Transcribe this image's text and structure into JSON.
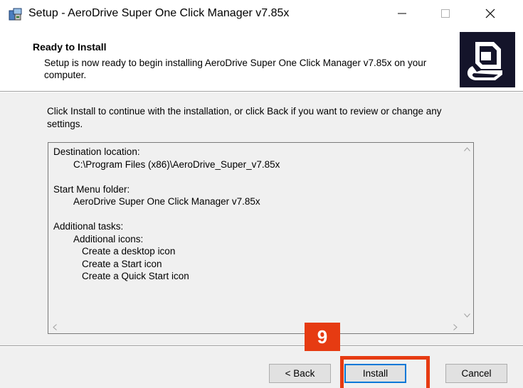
{
  "window": {
    "title": "Setup - AeroDrive Super One Click Manager v7.85x",
    "controls": {
      "minimize": "—",
      "maximize": "☐",
      "close": "✕"
    }
  },
  "header": {
    "title": "Ready to Install",
    "description": "Setup is now ready to begin installing AeroDrive Super One Click Manager v7.85x on your computer.",
    "logo_icon": "computer-install-icon"
  },
  "content": {
    "intro": "Click Install to continue with the installation, or click Back if you want to review or change any settings.",
    "memo": {
      "destination_label": "Destination location:",
      "destination_value": "C:\\Program Files (x86)\\AeroDrive_Super_v7.85x",
      "start_menu_label": "Start Menu folder:",
      "start_menu_value": "AeroDrive Super One Click Manager v7.85x",
      "tasks_label": "Additional tasks:",
      "icons_label": "Additional icons:",
      "tasks": [
        "Create a desktop icon",
        "Create a Start icon",
        "Create a Quick Start icon"
      ]
    }
  },
  "buttons": {
    "back": "< Back",
    "install": "Install",
    "cancel": "Cancel"
  },
  "annotation": {
    "step_number": "9",
    "color": "#e63b12"
  }
}
